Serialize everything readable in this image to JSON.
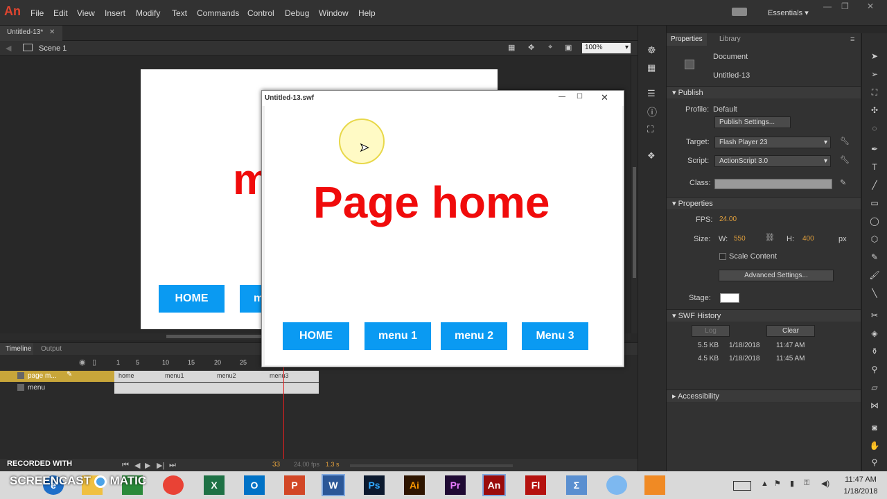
{
  "app": {
    "logo": "An",
    "menu": [
      "File",
      "Edit",
      "View",
      "Insert",
      "Modify",
      "Text",
      "Commands",
      "Control",
      "Debug",
      "Window",
      "Help"
    ],
    "workspace": "Essentials"
  },
  "doc": {
    "tab": "Untitled-13*",
    "scene": "Scene 1",
    "zoom": "100%"
  },
  "stage": {
    "partial_text": "m",
    "home_btn": "HOME",
    "partial_btn": "m"
  },
  "swf": {
    "title": "Untitled-13.swf",
    "heading": "Page home",
    "buttons": [
      "HOME",
      "menu 1",
      "menu 2",
      "Menu 3"
    ]
  },
  "timeline": {
    "tabs": [
      "Timeline",
      "Output"
    ],
    "ruler": [
      "1",
      "5",
      "10",
      "15",
      "20",
      "25"
    ],
    "layers": [
      {
        "name": "page m...",
        "frames": [
          "home",
          "menu1",
          "menu2",
          "menu3"
        ]
      },
      {
        "name": "menu"
      }
    ],
    "frame": "33",
    "fps": "24.00 fps",
    "time": "1.3 s"
  },
  "properties": {
    "tabs": [
      "Properties",
      "Library"
    ],
    "doc_type": "Document",
    "doc_name": "Untitled-13",
    "publish": {
      "header": "Publish",
      "profile_label": "Profile:",
      "profile": "Default",
      "settings_btn": "Publish Settings...",
      "target_label": "Target:",
      "target": "Flash Player 23",
      "script_label": "Script:",
      "script": "ActionScript 3.0",
      "class_label": "Class:"
    },
    "props": {
      "header": "Properties",
      "fps_label": "FPS:",
      "fps": "24.00",
      "size_label": "Size:",
      "w_label": "W:",
      "w": "550",
      "h_label": "H:",
      "h": "400",
      "unit": "px",
      "scale": "Scale Content",
      "advanced": "Advanced Settings...",
      "stage_label": "Stage:"
    },
    "history": {
      "header": "SWF History",
      "log": "Log",
      "clear": "Clear",
      "rows": [
        {
          "size": "5.5 KB",
          "date": "1/18/2018",
          "time": "11:47 AM"
        },
        {
          "size": "4.5 KB",
          "date": "1/18/2018",
          "time": "11:45 AM"
        }
      ]
    },
    "accessibility": "Accessibility"
  },
  "watermark": {
    "line1": "RECORDED WITH",
    "line2": "SCREENCAST",
    "line3": "MATIC"
  },
  "taskbar": {
    "apps": [
      "e",
      "X",
      "O",
      "P",
      "W",
      "Ps",
      "Ai",
      "Pr",
      "An",
      "Fl"
    ],
    "time": "11:47 AM",
    "date": "1/18/2018"
  },
  "colors": {
    "accent_red": "#f00b0b",
    "button_blue": "#0a9af2",
    "layer_highlight": "#c8a63a"
  }
}
